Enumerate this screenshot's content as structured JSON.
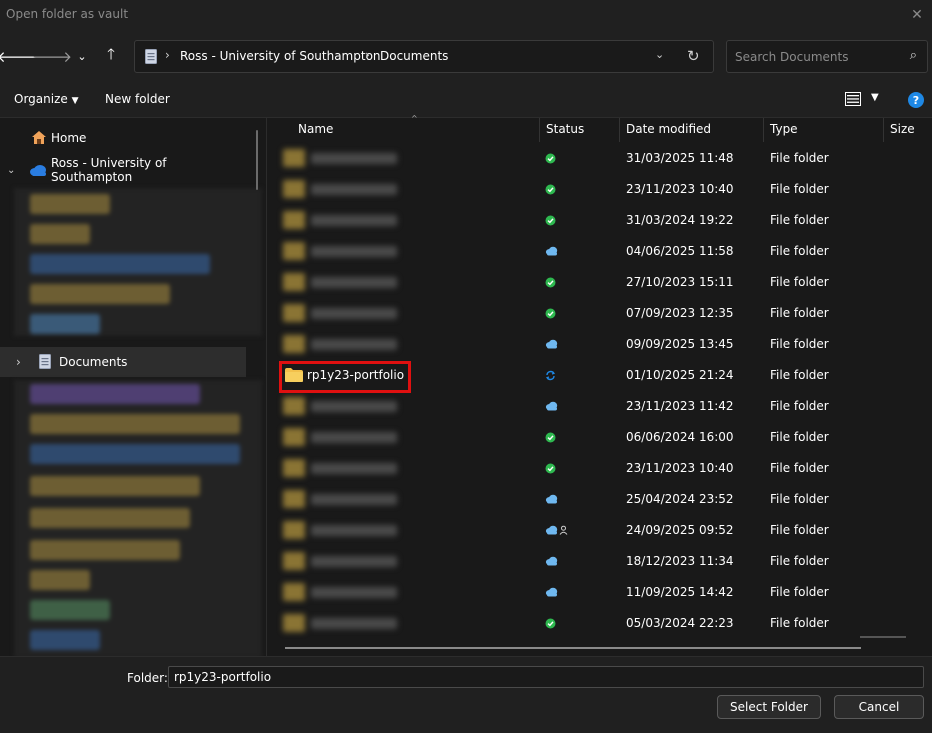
{
  "window": {
    "title": "Open folder as vault"
  },
  "navigation": {
    "address_segments": [
      "Ross - University of Southampton",
      "Documents"
    ],
    "search_placeholder": "Search Documents"
  },
  "commands": {
    "organize": "Organize",
    "new_folder": "New folder"
  },
  "sidebar": {
    "home": "Home",
    "onedrive": "Ross - University of Southampton",
    "documents": "Documents"
  },
  "columns": {
    "name": "Name",
    "status": "Status",
    "date": "Date modified",
    "type": "Type",
    "size": "Size"
  },
  "rows": [
    {
      "name": "",
      "status": "synced",
      "date": "31/03/2025 11:48",
      "type": "File folder"
    },
    {
      "name": "",
      "status": "synced",
      "date": "23/11/2023 10:40",
      "type": "File folder"
    },
    {
      "name": "",
      "status": "synced",
      "date": "31/03/2024 19:22",
      "type": "File folder"
    },
    {
      "name": "",
      "status": "cloud",
      "date": "04/06/2025 11:58",
      "type": "File folder"
    },
    {
      "name": "",
      "status": "synced",
      "date": "27/10/2023 15:11",
      "type": "File folder"
    },
    {
      "name": "",
      "status": "synced",
      "date": "07/09/2023 12:35",
      "type": "File folder"
    },
    {
      "name": "",
      "status": "cloud",
      "date": "09/09/2025 13:45",
      "type": "File folder"
    },
    {
      "name": "rp1y23-portfolio",
      "status": "syncing",
      "date": "01/10/2025 21:24",
      "type": "File folder"
    },
    {
      "name": "",
      "status": "cloud",
      "date": "23/11/2023 11:42",
      "type": "File folder"
    },
    {
      "name": "",
      "status": "synced",
      "date": "06/06/2024 16:00",
      "type": "File folder"
    },
    {
      "name": "",
      "status": "synced",
      "date": "23/11/2023 10:40",
      "type": "File folder"
    },
    {
      "name": "",
      "status": "cloud",
      "date": "25/04/2024 23:52",
      "type": "File folder"
    },
    {
      "name": "",
      "status": "cloud-shared",
      "date": "24/09/2025 09:52",
      "type": "File folder"
    },
    {
      "name": "",
      "status": "cloud",
      "date": "18/12/2023 11:34",
      "type": "File folder"
    },
    {
      "name": "",
      "status": "cloud",
      "date": "11/09/2025 14:42",
      "type": "File folder"
    },
    {
      "name": "",
      "status": "synced",
      "date": "05/03/2024 22:23",
      "type": "File folder"
    }
  ],
  "footer": {
    "folder_label": "Folder:",
    "folder_value": "rp1y23-portfolio",
    "select_button": "Select Folder",
    "cancel_button": "Cancel"
  },
  "colors": {
    "synced": "#2eb84f",
    "cloud": "#6fb8f0",
    "highlight": "#e01010",
    "folder": "#f3c14b",
    "accent": "#1e88e5"
  }
}
